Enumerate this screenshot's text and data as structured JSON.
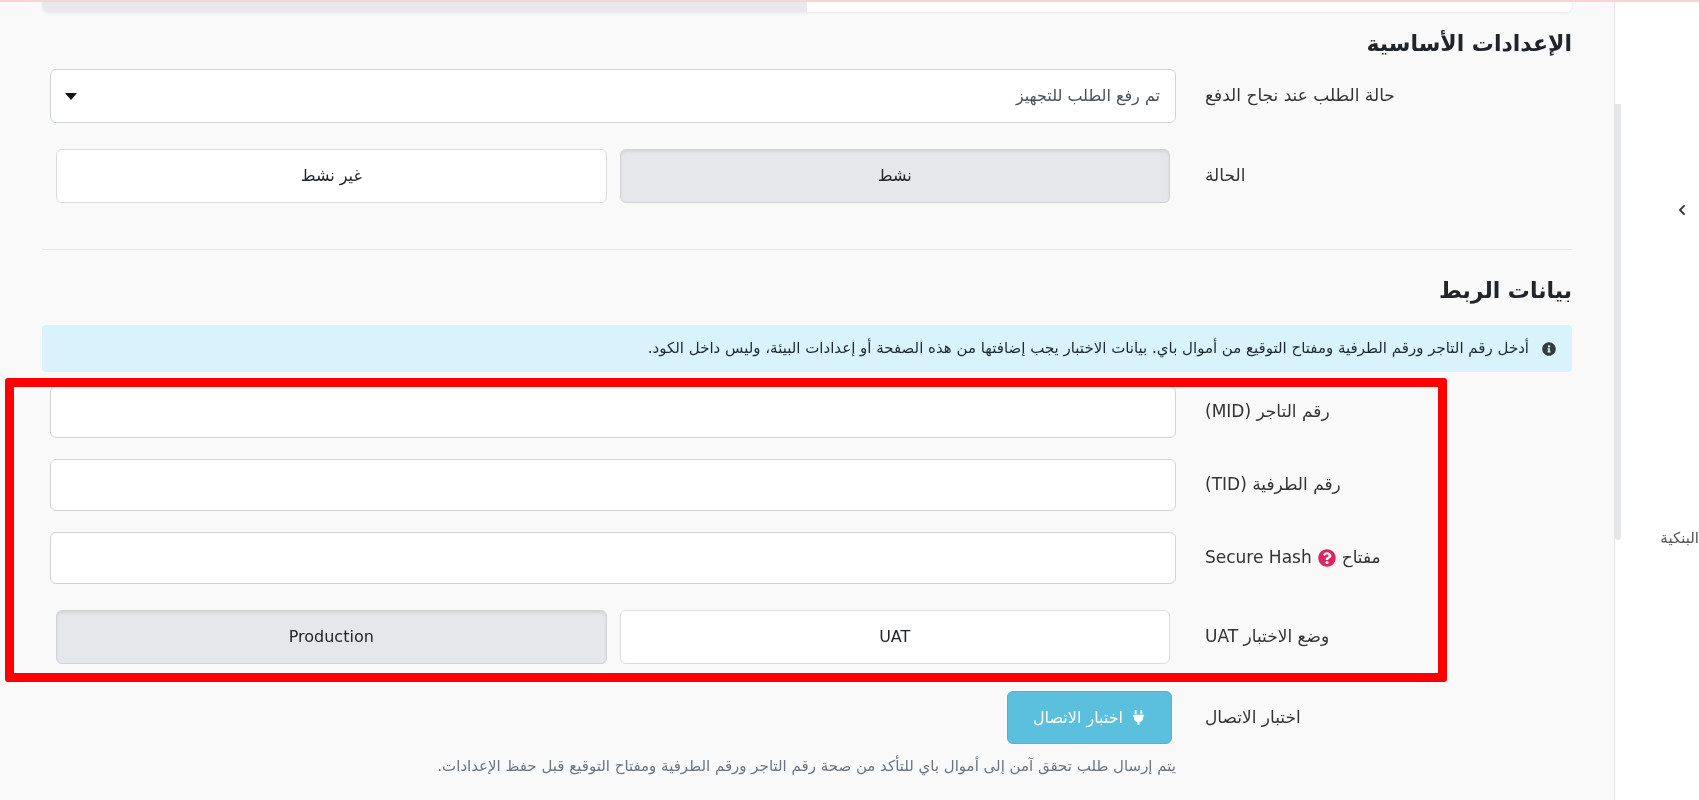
{
  "sections": [
    {
      "title": "الإعدادات الأساسية",
      "rows": [
        {
          "kind": "select",
          "label": "حالة الطلب عند نجاح الدفع",
          "value": "تم رفع الطلب للتجهيز",
          "highlighted": false
        },
        {
          "kind": "toggle",
          "label": "الحالة",
          "highlighted": false,
          "options": [
            {
              "label": "نشط",
              "selected": true
            },
            {
              "label": "غير نشط",
              "selected": false
            }
          ]
        }
      ]
    },
    {
      "title": "بيانات الربط",
      "notice": "أدخل رقم التاجر ورقم الطرفية ومفتاح التوقيع من أموال باي. بيانات الاختبار يجب إضافتها من هذه الصفحة أو إعدادات البيئة، وليس داخل الكود.",
      "rows": [
        {
          "kind": "input",
          "label": "رقم التاجر (MID)",
          "highlighted": true
        },
        {
          "kind": "input",
          "label": "رقم الطرفية (TID)",
          "highlighted": true
        },
        {
          "kind": "input",
          "label": "مفتاح",
          "label_suffix": "Secure Hash",
          "help": true,
          "highlighted": true
        },
        {
          "kind": "toggle",
          "label": "وضع الاختبار UAT",
          "highlighted": true,
          "options": [
            {
              "label": "UAT",
              "selected": false
            },
            {
              "label": "Production",
              "selected": true
            }
          ]
        },
        {
          "kind": "button",
          "label": "اختبار الاتصال",
          "button": "اختبار الاتصال",
          "hint": "يتم إرسال طلب تحقق آمن إلى أموال باي للتأكد من صحة رقم التاجر ورقم الطرفية ومفتاح التوقيع قبل حفظ الإعدادات.",
          "highlighted": false
        }
      ]
    }
  ],
  "side_panel": {
    "text": "البنكية"
  }
}
